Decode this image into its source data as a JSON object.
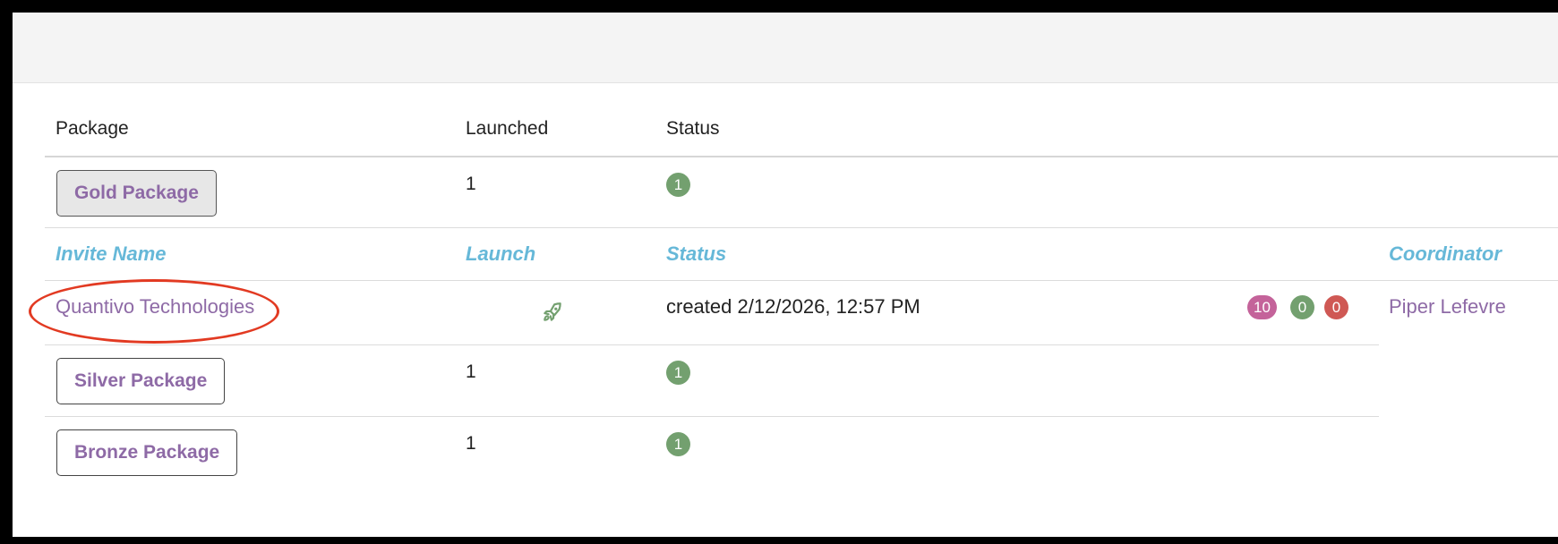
{
  "table": {
    "headers": {
      "package": "Package",
      "launched": "Launched",
      "status": "Status"
    },
    "packages": [
      {
        "name": "Gold Package",
        "launched": "1",
        "status_count": "1"
      },
      {
        "name": "Silver Package",
        "launched": "1",
        "status_count": "1"
      },
      {
        "name": "Bronze Package",
        "launched": "1",
        "status_count": "1"
      }
    ]
  },
  "invite_table": {
    "headers": {
      "invite_name": "Invite Name",
      "launch": "Launch",
      "status": "Status",
      "coordinator": "Coordinator"
    },
    "rows": [
      {
        "invite_name": "Quantivo Technologies",
        "launch_icon": "rocket-icon",
        "status": "created 2/12/2026, 12:57 PM",
        "counts": [
          "10",
          "0",
          "0"
        ],
        "coordinator": "Piper Lefevre"
      }
    ]
  },
  "colors": {
    "accent_link": "#8e6aa6",
    "subheader": "#66b8d8",
    "badge_green": "#73a06f",
    "badge_pink": "#c4639a",
    "badge_red": "#cf5854",
    "annotation": "#e23a22"
  }
}
